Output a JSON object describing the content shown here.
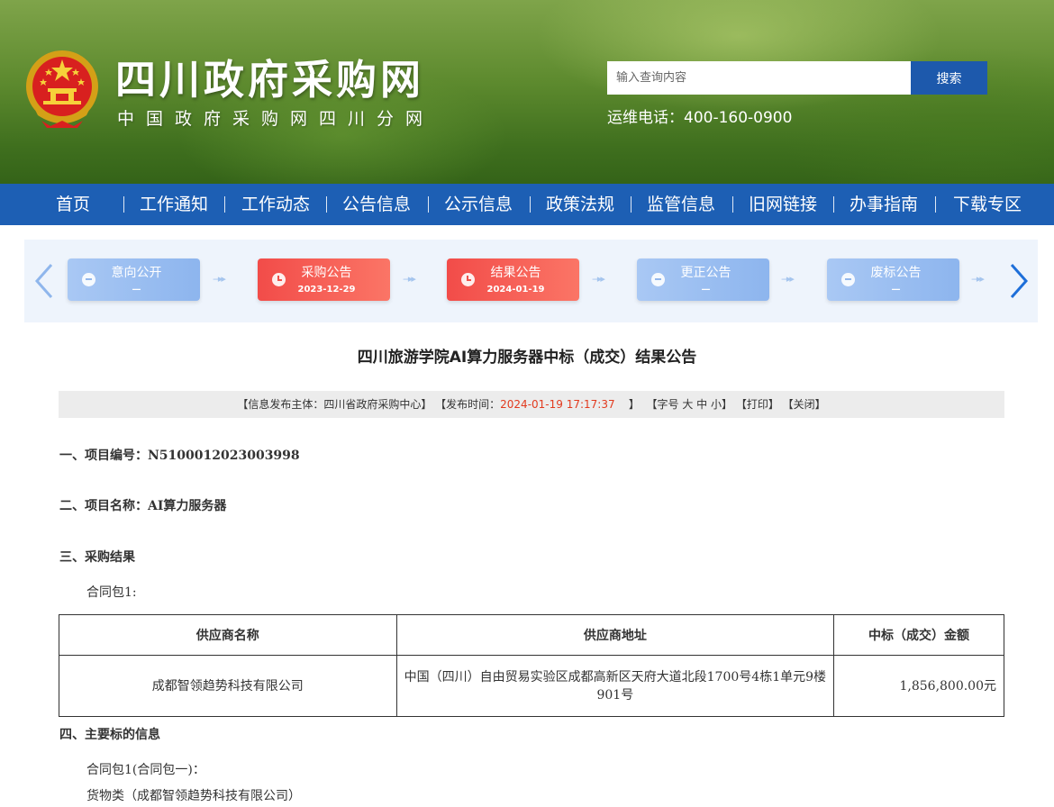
{
  "header": {
    "site_title": "四川政府采购网",
    "site_subtitle": "中国政府采购网四川分网",
    "search_placeholder": "输入查询内容",
    "search_button": "搜索",
    "hotline": "运维电话：400-160-0900"
  },
  "nav": {
    "items": [
      "首页",
      "工作通知",
      "工作动态",
      "公告信息",
      "公示信息",
      "政策法规",
      "监管信息",
      "旧网链接",
      "办事指南",
      "下载专区"
    ]
  },
  "progress": {
    "steps": [
      {
        "label": "意向公开",
        "date": "—",
        "state": "inactive"
      },
      {
        "label": "采购公告",
        "date": "2023-12-29",
        "state": "active"
      },
      {
        "label": "结果公告",
        "date": "2024-01-19",
        "state": "active"
      },
      {
        "label": "更正公告",
        "date": "—",
        "state": "inactive"
      },
      {
        "label": "废标公告",
        "date": "—",
        "state": "inactive"
      }
    ]
  },
  "article": {
    "title": "四川旅游学院AI算力服务器中标（成交）结果公告",
    "info": {
      "publisher_prefix": "【信息发布主体：四川省政府采购中心】 【发布时间：",
      "publish_time": "2024-01-19 17:17:37",
      "publisher_suffix": "】",
      "font_size": "【字号 大 中 小】",
      "print": "【打印】",
      "close": "【关闭】"
    },
    "sections": {
      "s1_label": "一、项目编号：",
      "s1_value": "N5100012023003998",
      "s2_label": "二、项目名称：",
      "s2_value": "AI算力服务器",
      "s3_label": "三、采购结果",
      "s3_package": "合同包1:",
      "s4_label": "四、主要标的信息",
      "s4_package": "合同包1(合同包一)：",
      "s4_category": "货物类（成都智领趋势科技有限公司）"
    },
    "table": {
      "headers": [
        "供应商名称",
        "供应商地址",
        "中标（成交）金额"
      ],
      "rows": [
        [
          "成都智领趋势科技有限公司",
          "中国（四川）自由贸易实验区成都高新区天府大道北段1700号4栋1单元9楼901号",
          "1,856,800.00元"
        ]
      ]
    }
  },
  "colors": {
    "nav_blue": "#1d5fb4",
    "search_button": "#1d59ac",
    "active_step": "#f24c49",
    "inactive_step": "#8db5ee",
    "highlight_red": "#e23a1e"
  },
  "icons": [
    "national-emblem-icon",
    "chevron-left-icon",
    "chevron-right-icon",
    "step-clock-icon",
    "step-minus-icon"
  ]
}
